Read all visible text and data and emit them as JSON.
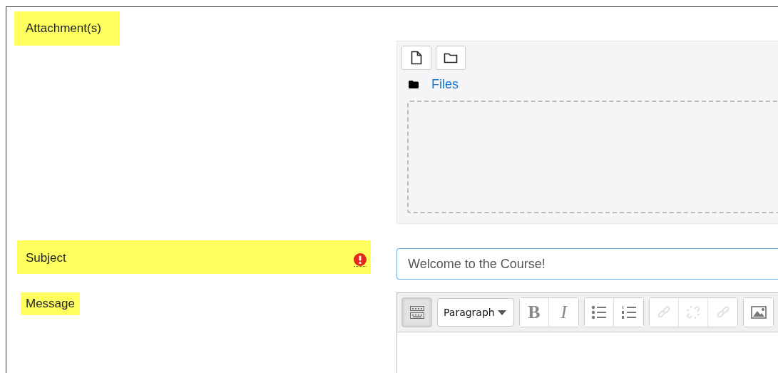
{
  "fields": [
    {
      "kind": "filepicker",
      "label": "Attachment(s)",
      "required": false,
      "folder": "Files"
    },
    {
      "kind": "text",
      "label": "Subject",
      "required": true,
      "value": "Welcome to the Course!"
    },
    {
      "kind": "editor",
      "label": "Message",
      "required": false,
      "format": "Paragraph",
      "toolbar": [
        [
          {
            "kind": "toggle",
            "pressed": true,
            "disabled": false
          }
        ],
        [
          {
            "kind": "bold",
            "label": "B",
            "disabled": false
          },
          {
            "kind": "italic",
            "label": "I",
            "disabled": false
          }
        ],
        [
          {
            "kind": "bullets",
            "disabled": false
          },
          {
            "kind": "numbers",
            "disabled": false
          }
        ],
        [
          {
            "kind": "link",
            "disabled": true
          },
          {
            "kind": "unlink",
            "disabled": true
          },
          {
            "kind": "link",
            "disabled": true
          }
        ],
        [
          {
            "kind": "image",
            "disabled": false
          }
        ]
      ]
    }
  ]
}
